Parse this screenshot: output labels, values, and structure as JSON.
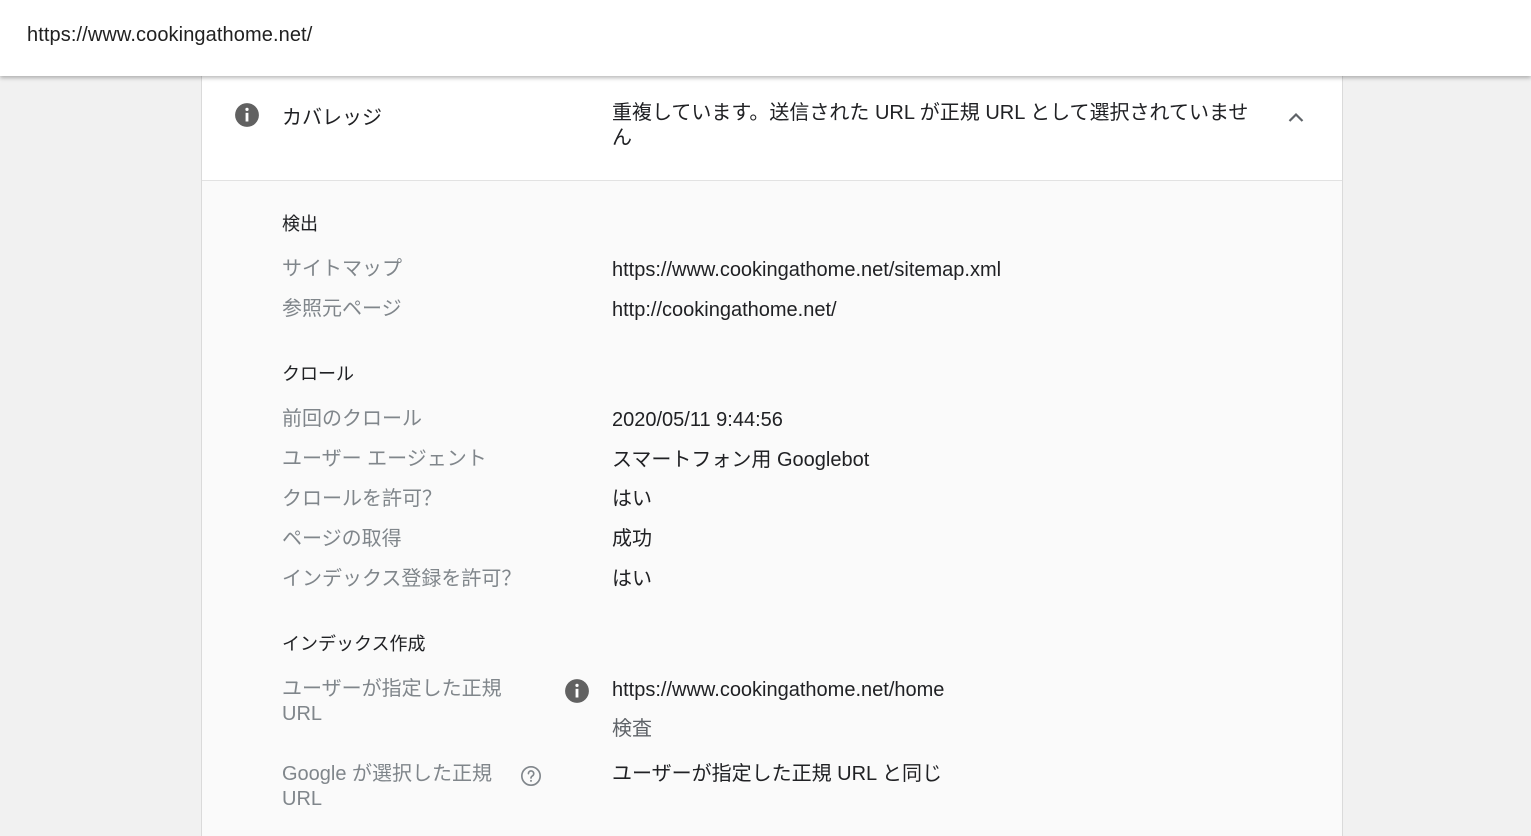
{
  "url_bar": {
    "url": "https://www.cookingathome.net/"
  },
  "coverage": {
    "label": "カバレッジ",
    "value": "重複しています。送信された URL が正規 URL として選択されていません"
  },
  "sections": {
    "detection": {
      "heading": "検出",
      "sitemap_label": "サイトマップ",
      "sitemap_value": "https://www.cookingathome.net/sitemap.xml",
      "referrer_label": "参照元ページ",
      "referrer_value": "http://cookingathome.net/"
    },
    "crawl": {
      "heading": "クロール",
      "last_crawl_label": "前回のクロール",
      "last_crawl_value": "2020/05/11 9:44:56",
      "user_agent_label": "ユーザー エージェント",
      "user_agent_value": "スマートフォン用 Googlebot",
      "crawl_allowed_label": "クロールを許可？",
      "crawl_allowed_value": "はい",
      "page_fetch_label": "ページの取得",
      "page_fetch_value": "成功",
      "indexing_allowed_label": "インデックス登録を許可？",
      "indexing_allowed_value": "はい"
    },
    "indexing": {
      "heading": "インデックス作成",
      "user_canonical_label": "ユーザーが指定した正規 URL",
      "user_canonical_value": "https://www.cookingathome.net/home",
      "inspect_link": "検査",
      "google_canonical_label": "Google が選択した正規 URL",
      "google_canonical_value": "ユーザーが指定した正規 URL と同じ"
    }
  },
  "colors": {
    "icon_gray": "#616161",
    "label_gray": "#80868b",
    "text": "#202124"
  },
  "icons": [
    "info-icon",
    "chevron-up-icon",
    "help-icon"
  ]
}
